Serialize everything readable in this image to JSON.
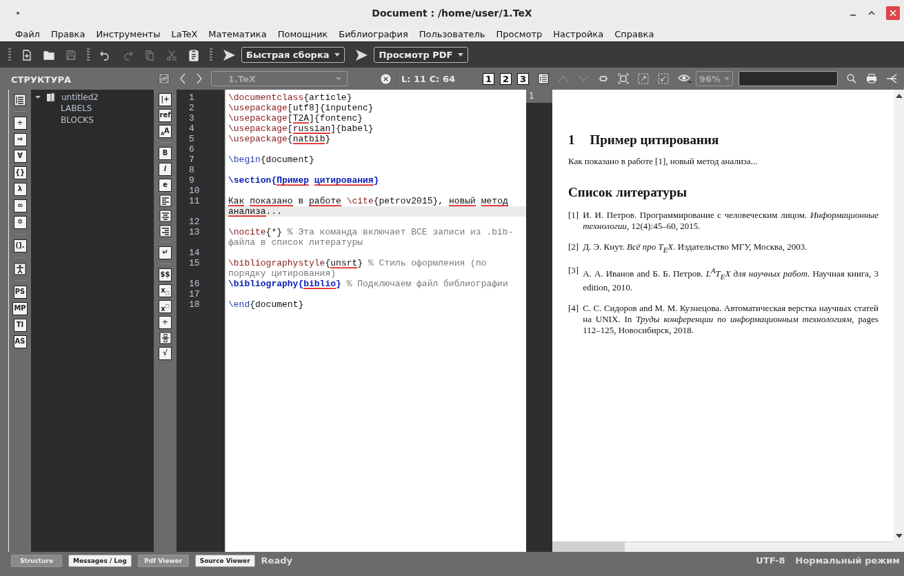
{
  "window": {
    "title": "Document : /home/user/1.TeX"
  },
  "menu": [
    "Файл",
    "Правка",
    "Инструменты",
    "LaTeX",
    "Математика",
    "Помощник",
    "Библиография",
    "Пользователь",
    "Просмотр",
    "Настройка",
    "Справка"
  ],
  "toolbar": {
    "file_buttons": [
      {
        "kind": "new",
        "disabled": false
      },
      {
        "kind": "open",
        "disabled": false
      },
      {
        "kind": "save",
        "disabled": true
      }
    ],
    "edit_buttons": [
      {
        "kind": "undo",
        "disabled": false
      },
      {
        "kind": "redo",
        "disabled": true
      },
      {
        "kind": "copy",
        "disabled": true
      },
      {
        "kind": "cut",
        "disabled": true
      },
      {
        "kind": "paste",
        "disabled": false
      }
    ],
    "build": "Быстрая сборка",
    "view": "Просмотр PDF"
  },
  "structure": {
    "title": "СТРУКТУРА",
    "tools": [
      {
        "kind": "list"
      },
      {
        "kind": "separator"
      },
      {
        "kind": "glyph",
        "glyph": "÷"
      },
      {
        "kind": "glyph",
        "glyph": "⇒"
      },
      {
        "kind": "glyph",
        "glyph": "∀"
      },
      {
        "kind": "glyph",
        "glyph": "{}"
      },
      {
        "kind": "glyph",
        "glyph": "λ"
      },
      {
        "kind": "glyph",
        "glyph": "∞"
      },
      {
        "kind": "glyph",
        "glyph": "✲"
      },
      {
        "kind": "separator"
      },
      {
        "kind": "glyph",
        "glyph": "(]."
      },
      {
        "kind": "separator"
      },
      {
        "kind": "figure"
      },
      {
        "kind": "separator"
      },
      {
        "kind": "glyph",
        "glyph": "PS"
      },
      {
        "kind": "glyph",
        "glyph": "MP"
      },
      {
        "kind": "glyph",
        "glyph": "TI"
      },
      {
        "kind": "glyph",
        "glyph": "AS"
      }
    ],
    "tree": [
      {
        "label": "untitled2",
        "expanded": true,
        "children": [
          {
            "label": "LABELS"
          },
          {
            "label": "BLOCKS"
          }
        ]
      }
    ]
  },
  "editor": {
    "file": "1.TeX",
    "position": "L: 11 C: 64",
    "tools": [
      {
        "kind": "glyph",
        "glyph": "|+"
      },
      {
        "kind": "glyph",
        "glyph": "ref"
      },
      {
        "kind": "glyph",
        "glyph": "$_{A}$A"
      },
      {
        "kind": "separator"
      },
      {
        "kind": "glyph",
        "glyph": "B"
      },
      {
        "kind": "glyph",
        "glyph": "*i*"
      },
      {
        "kind": "glyph",
        "glyph": "e"
      },
      {
        "kind": "align-left"
      },
      {
        "kind": "align-center"
      },
      {
        "kind": "align-right"
      },
      {
        "kind": "separator"
      },
      {
        "kind": "glyph",
        "glyph": "↵"
      },
      {
        "kind": "separator"
      },
      {
        "kind": "glyph",
        "glyph": "$$"
      },
      {
        "kind": "glyph",
        "glyph": "x$_{□}$"
      },
      {
        "kind": "glyph",
        "glyph": "x$^{□}$"
      },
      {
        "kind": "glyph",
        "glyph": "÷"
      },
      {
        "kind": "fraction"
      },
      {
        "kind": "glyph",
        "glyph": "√"
      }
    ],
    "lines": [
      {
        "number": "1",
        "current": false,
        "rows": [
          [
            {
              "kind": "command",
              "text": "\\documentclass",
              "misspelled": false
            },
            {
              "kind": "text",
              "text": "{article}",
              "misspelled": false
            }
          ]
        ]
      },
      {
        "number": "2",
        "current": false,
        "rows": [
          [
            {
              "kind": "command",
              "text": "\\usepackage",
              "misspelled": false
            },
            {
              "kind": "text",
              "text": "[utf8]{inputenc}",
              "misspelled": false
            }
          ]
        ]
      },
      {
        "number": "3",
        "current": false,
        "rows": [
          [
            {
              "kind": "command",
              "text": "\\usepackage",
              "misspelled": false
            },
            {
              "kind": "text",
              "text": "[",
              "misspelled": false
            },
            {
              "kind": "text",
              "text": "T2A",
              "misspelled": true
            },
            {
              "kind": "text",
              "text": "]{fontenc}",
              "misspelled": false
            }
          ]
        ]
      },
      {
        "number": "4",
        "current": false,
        "rows": [
          [
            {
              "kind": "command",
              "text": "\\usepackage",
              "misspelled": false
            },
            {
              "kind": "text",
              "text": "[",
              "misspelled": false
            },
            {
              "kind": "text",
              "text": "russian",
              "misspelled": true
            },
            {
              "kind": "text",
              "text": "]{babel}",
              "misspelled": false
            }
          ]
        ]
      },
      {
        "number": "5",
        "current": false,
        "rows": [
          [
            {
              "kind": "command",
              "text": "\\usepackage",
              "misspelled": false
            },
            {
              "kind": "text",
              "text": "{",
              "misspelled": false
            },
            {
              "kind": "text",
              "text": "natbib",
              "misspelled": true
            },
            {
              "kind": "text",
              "text": "}",
              "misspelled": false
            }
          ]
        ]
      },
      {
        "number": "6",
        "current": false
      },
      {
        "number": "7",
        "current": false,
        "rows": [
          [
            {
              "kind": "environment",
              "text": "\\begin",
              "misspelled": false
            },
            {
              "kind": "text",
              "text": "{document}",
              "misspelled": false
            }
          ]
        ]
      },
      {
        "number": "8",
        "current": false
      },
      {
        "number": "9",
        "current": false,
        "rows": [
          [
            {
              "kind": "sectioning",
              "text": "\\section{",
              "misspelled": false
            },
            {
              "kind": "sectioning",
              "text": "Пример",
              "misspelled": true
            },
            {
              "kind": "sectioning",
              "text": " ",
              "misspelled": false
            },
            {
              "kind": "sectioning",
              "text": "цитирования",
              "misspelled": true
            },
            {
              "kind": "sectioning",
              "text": "}",
              "misspelled": false
            }
          ]
        ]
      },
      {
        "number": "10",
        "current": false
      },
      {
        "number": "11",
        "current": true,
        "rows": [
          [
            {
              "kind": "text",
              "text": "Как",
              "misspelled": true
            },
            {
              "kind": "text",
              "text": " ",
              "misspelled": false
            },
            {
              "kind": "text",
              "text": "показано",
              "misspelled": true
            },
            {
              "kind": "text",
              "text": " в ",
              "misspelled": false
            },
            {
              "kind": "text",
              "text": "работе",
              "misspelled": true
            },
            {
              "kind": "text",
              "text": " ",
              "misspelled": false
            },
            {
              "kind": "command",
              "text": "\\cite",
              "misspelled": false
            },
            {
              "kind": "text",
              "text": "{petrov2015}, ",
              "misspelled": false
            },
            {
              "kind": "text",
              "text": "новый",
              "misspelled": true
            },
            {
              "kind": "text",
              "text": " ",
              "misspelled": false
            },
            {
              "kind": "text",
              "text": "метод",
              "misspelled": true
            }
          ],
          [
            {
              "kind": "text",
              "text": "анализа",
              "misspelled": true
            },
            {
              "kind": "text",
              "text": "...",
              "misspelled": false
            }
          ]
        ]
      },
      {
        "number": "12",
        "current": false
      },
      {
        "number": "13",
        "current": false,
        "rows": [
          [
            {
              "kind": "command",
              "text": "\\nocite",
              "misspelled": false
            },
            {
              "kind": "text",
              "text": "{*}",
              "misspelled": false
            },
            {
              "kind": "comment",
              "text": " % Эта команда включает ВСЕ записи из .bib-",
              "misspelled": false
            }
          ],
          [
            {
              "kind": "comment",
              "text": "файла в список литературы",
              "misspelled": false
            }
          ]
        ]
      },
      {
        "number": "14",
        "current": false
      },
      {
        "number": "15",
        "current": false,
        "rows": [
          [
            {
              "kind": "command",
              "text": "\\bibliographystyle",
              "misspelled": false
            },
            {
              "kind": "text",
              "text": "{",
              "misspelled": false
            },
            {
              "kind": "text",
              "text": "unsrt",
              "misspelled": true
            },
            {
              "kind": "text",
              "text": "}",
              "misspelled": false
            },
            {
              "kind": "comment",
              "text": " % Стиль оформления (по",
              "misspelled": false
            }
          ],
          [
            {
              "kind": "comment",
              "text": "порядку цитирования)",
              "misspelled": false
            }
          ]
        ]
      },
      {
        "number": "16",
        "current": false,
        "rows": [
          [
            {
              "kind": "sectioning",
              "text": "\\bibliography{",
              "misspelled": false
            },
            {
              "kind": "sectioning",
              "text": "biblio",
              "misspelled": true
            },
            {
              "kind": "sectioning",
              "text": "}",
              "misspelled": false
            },
            {
              "kind": "comment",
              "text": " % Подключаем файл библиографии",
              "misspelled": false
            }
          ]
        ]
      },
      {
        "number": "17",
        "current": false
      },
      {
        "number": "18",
        "current": false,
        "rows": [
          [
            {
              "kind": "environment",
              "text": "\\end",
              "misspelled": false
            },
            {
              "kind": "text",
              "text": "{document}",
              "misspelled": false
            }
          ]
        ]
      }
    ]
  },
  "viewer": {
    "marks": [
      "1",
      "2",
      "3"
    ],
    "nav_buttons": [
      {
        "kind": "up",
        "disabled": true
      },
      {
        "kind": "down",
        "disabled": true
      }
    ],
    "zoom": "96%",
    "page": "1",
    "document": {
      "section_number": "1",
      "section_title": "Пример цитирования",
      "paragraph": "Как показано в работе [1], новый метод анализа...",
      "bibliography_title": "Список литературы",
      "references": [
        {
          "label": "[1]",
          "parts": [
            {
              "text": "И. И. Петров. Программирование с человеческим лицом. ",
              "italic": false
            },
            {
              "text": "Информационные технологии",
              "italic": true
            },
            {
              "text": ", 12(4):45–60, 2015.",
              "italic": false
            }
          ]
        },
        {
          "label": "[2]",
          "parts": [
            {
              "text": "Д. Э. Кнут. ",
              "italic": false
            },
            {
              "text": "Всё про T$_{E}$X",
              "italic": true
            },
            {
              "text": ". Издательство МГУ, Москва, 2003.",
              "italic": false
            }
          ]
        },
        {
          "label": "[3]",
          "parts": [
            {
              "text": "А. А. Иванов and Б. Б. Петров. ",
              "italic": false
            },
            {
              "text": "L$^{A}$T$_{E}$X для научных работ",
              "italic": true
            },
            {
              "text": ". Научная книга, 3 edition, 2010.",
              "italic": false
            }
          ]
        },
        {
          "label": "[4]",
          "parts": [
            {
              "text": "С. С. Сидоров and М. М. Кузнецова. Автоматическая верстка научных статей на UNIX. In ",
              "italic": false
            },
            {
              "text": "Труды конференции по информационным технологиям",
              "italic": true
            },
            {
              "text": ", pages 112–125, Новосибирск, 2018.",
              "italic": false
            }
          ]
        }
      ]
    }
  },
  "status": {
    "panels": [
      {
        "label": "Structure",
        "pressed": true
      },
      {
        "label": "Messages / Log",
        "pressed": false
      },
      {
        "label": "Pdf Viewer",
        "pressed": true
      },
      {
        "label": "Source Viewer",
        "pressed": false
      }
    ],
    "message": "Ready",
    "encoding": "UTF-8",
    "mode": "Нормальный режим"
  }
}
